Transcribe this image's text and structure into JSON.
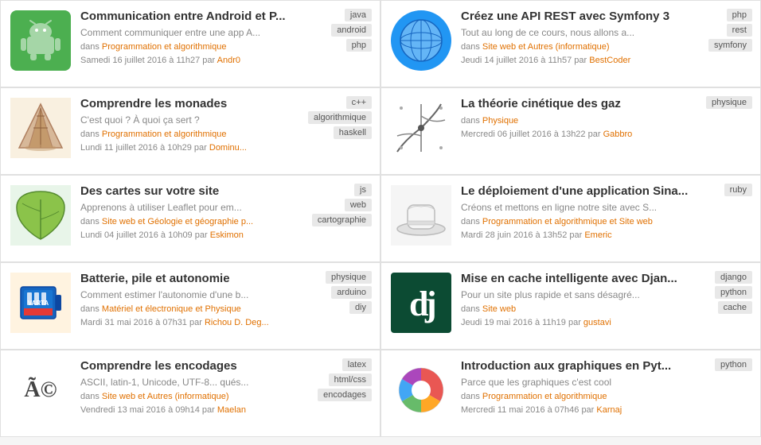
{
  "cards": [
    {
      "id": "card-android",
      "title": "Communication entre Android et P...",
      "desc": "Comment communiquer entre une app A...",
      "meta_prefix": "dans",
      "category": "Programmation et algorithmique",
      "date": "Samedi 16 juillet 2016 à 11h27 par",
      "author": "Andr0",
      "tags": [
        "java",
        "android",
        "php"
      ],
      "thumb_type": "android"
    },
    {
      "id": "card-symfony",
      "title": "Créez une API REST avec Symfony 3",
      "desc": "Tout au long de ce cours, nous allons a...",
      "meta_prefix": "dans",
      "category": "Site web et Autres (informatique)",
      "date": "Jeudi 14 juillet 2016 à 11h57 par",
      "author": "BestCoder",
      "tags": [
        "php",
        "rest",
        "symfony"
      ],
      "thumb_type": "globe"
    },
    {
      "id": "card-monade",
      "title": "Comprendre les monades",
      "desc": "C'est quoi ? À quoi ça sert ?",
      "meta_prefix": "dans",
      "category": "Programmation et algorithmique",
      "date": "Lundi 11 juillet 2016 à 10h29 par",
      "author": "Dominu...",
      "tags": [
        "c++",
        "algorithmique",
        "haskell"
      ],
      "thumb_type": "monade"
    },
    {
      "id": "card-kinetic",
      "title": "La théorie cinétique des gaz",
      "desc": "",
      "meta_prefix": "dans",
      "category": "Physique",
      "date": "Mercredi 06 juillet 2016 à 13h22 par",
      "author": "Gabbro",
      "tags": [
        "physique"
      ],
      "thumb_type": "kinetic"
    },
    {
      "id": "card-map",
      "title": "Des cartes sur votre site",
      "desc": "Apprenons à utiliser Leaflet pour em...",
      "meta_prefix": "dans",
      "category": "Site web et Géologie et géographie p...",
      "date": "Lundi 04 juillet 2016 à 10h09 par",
      "author": "Eskimon",
      "tags": [
        "js",
        "web",
        "cartographie"
      ],
      "thumb_type": "map"
    },
    {
      "id": "card-sina",
      "title": "Le déploiement d'une application Sina...",
      "desc": "Créons et mettons en ligne notre site avec S...",
      "meta_prefix": "dans",
      "category": "Programmation et algorithmique et Site web",
      "date": "Mardi 28 juin 2016 à 13h52 par",
      "author": "Emeric",
      "tags": [
        "ruby"
      ],
      "thumb_type": "hat"
    },
    {
      "id": "card-battery",
      "title": "Batterie, pile et autonomie",
      "desc": "Comment estimer l'autonomie d'une b...",
      "meta_prefix": "dans",
      "category": "Matériel et électronique et Physique",
      "date": "Mardi 31 mai 2016 à 07h31 par",
      "author": "Richou D. Deg...",
      "tags": [
        "physique",
        "arduino",
        "diy"
      ],
      "thumb_type": "battery"
    },
    {
      "id": "card-django",
      "title": "Mise en cache intelligente avec Djan...",
      "desc": "Pour un site plus rapide et sans désagré...",
      "meta_prefix": "dans",
      "category": "Site web",
      "date": "Jeudi 19 mai 2016 à 11h19 par",
      "author": "gustavi",
      "tags": [
        "django",
        "python",
        "cache"
      ],
      "thumb_type": "django"
    },
    {
      "id": "card-encoding",
      "title": "Comprendre les encodages",
      "desc": "ASCII, latin-1, Unicode, UTF-8... qués...",
      "meta_prefix": "dans",
      "category": "Site web et Autres (informatique)",
      "date": "Vendredi 13 mai 2016 à 09h14 par",
      "author": "Maelan",
      "tags": [
        "latex",
        "html/css",
        "encodages"
      ],
      "thumb_type": "encoding"
    },
    {
      "id": "card-python-charts",
      "title": "Introduction aux graphiques en Pyt...",
      "desc": "Parce que les graphiques c'est cool",
      "meta_prefix": "dans",
      "category": "Programmation et algorithmique",
      "date": "Mercredi 11 mai 2016 à 07h46 par",
      "author": "Karnaj",
      "tags": [
        "python"
      ],
      "thumb_type": "chart"
    }
  ]
}
